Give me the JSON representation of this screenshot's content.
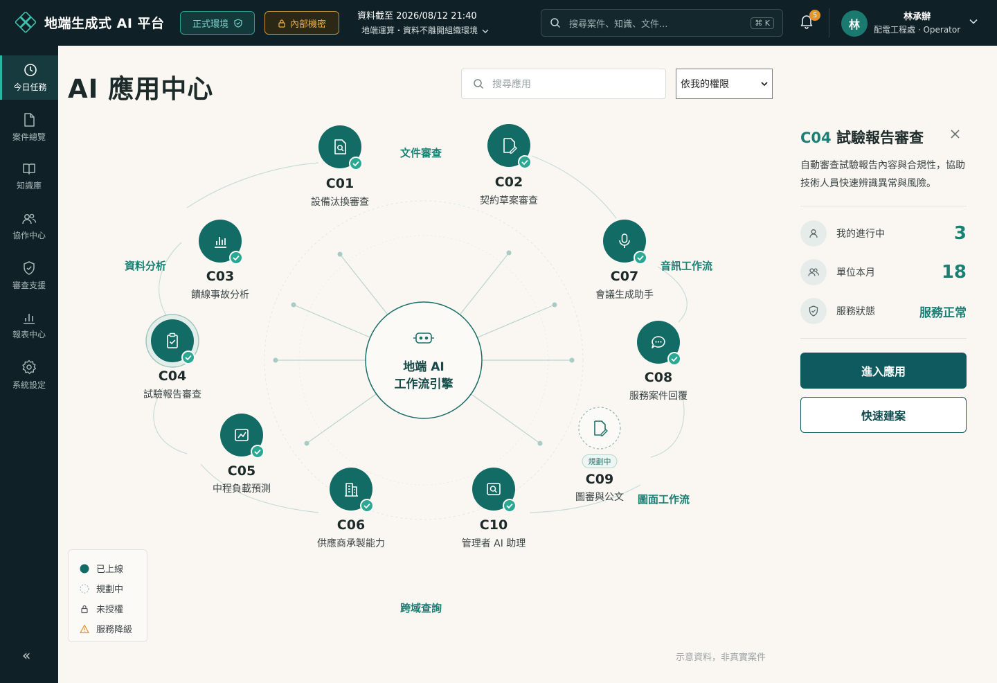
{
  "header": {
    "brand": "地端生成式 AI 平台",
    "env_label": "正式環境",
    "confidential_label": "內部機密",
    "data_as_of": "資料截至 2026/08/12 21:40",
    "data_scope": "地端運算・資料不離開組織環境",
    "search_placeholder": "搜尋案件、知識、文件...",
    "search_shortcut": "⌘ K",
    "notification_count": "5",
    "user_initial": "林",
    "user_name": "林承辦",
    "user_role": "配電工程處 · Operator"
  },
  "sidebar": {
    "items": [
      {
        "label": "今日任務",
        "icon": "clock-icon",
        "active": true
      },
      {
        "label": "案件總覽",
        "icon": "document-icon"
      },
      {
        "label": "知識庫",
        "icon": "book-icon"
      },
      {
        "label": "協作中心",
        "icon": "users-icon"
      },
      {
        "label": "審查支援",
        "icon": "shield-check-icon"
      },
      {
        "label": "報表中心",
        "icon": "bar-chart-icon"
      },
      {
        "label": "系統設定",
        "icon": "gear-icon"
      }
    ],
    "collapse_label": "«"
  },
  "main": {
    "title": "AI 應用中心",
    "search_placeholder": "搜尋應用",
    "filter_value": "依我的權限"
  },
  "hub": {
    "line1": "地端 AI",
    "line2": "工作流引擎"
  },
  "categories": [
    "文件審查",
    "資料分析",
    "音訊工作流",
    "圖面工作流",
    "跨域查詢"
  ],
  "apps": [
    {
      "code": "C01",
      "name": "設備汰換審查",
      "status": "online",
      "icon": "doc-search-icon"
    },
    {
      "code": "C02",
      "name": "契約草案審查",
      "status": "online",
      "icon": "doc-edit-icon"
    },
    {
      "code": "C03",
      "name": "饋線事故分析",
      "status": "online",
      "icon": "bar-chart-icon"
    },
    {
      "code": "C07",
      "name": "會議生成助手",
      "status": "online",
      "icon": "microphone-icon"
    },
    {
      "code": "C04",
      "name": "試驗報告審查",
      "status": "online",
      "icon": "clipboard-check-icon",
      "selected": true
    },
    {
      "code": "C08",
      "name": "服務案件回覆",
      "status": "online",
      "icon": "chat-icon"
    },
    {
      "code": "C05",
      "name": "中程負載預測",
      "status": "online",
      "icon": "line-chart-icon"
    },
    {
      "code": "C06",
      "name": "供應商承製能力",
      "status": "online",
      "icon": "building-icon"
    },
    {
      "code": "C10",
      "name": "管理者 AI 助理",
      "status": "online",
      "icon": "image-search-icon"
    },
    {
      "code": "C09",
      "name": "圖審與公文",
      "status": "planning",
      "icon": "doc-edit-icon",
      "badge": "規劃中"
    }
  ],
  "legend": [
    {
      "label": "已上線",
      "icon": "filled-dot-icon"
    },
    {
      "label": "規劃中",
      "icon": "dashed-circle-icon"
    },
    {
      "label": "未授權",
      "icon": "lock-icon"
    },
    {
      "label": "服務降級",
      "icon": "warning-icon"
    }
  ],
  "note": "示意資料，非真實案件",
  "detail": {
    "code": "C04",
    "title": "試驗報告審查",
    "description": "自動審查試驗報告內容與合規性，協助技術人員快速辨識異常與風險。",
    "stats": [
      {
        "label": "我的進行中",
        "value": "3",
        "icon": "user-icon"
      },
      {
        "label": "單位本月",
        "value": "18",
        "icon": "users-icon"
      },
      {
        "label": "服務狀態",
        "value": "服務正常",
        "icon": "shield-check-icon"
      }
    ],
    "enter_label": "進入應用",
    "quick_label": "快速建案"
  },
  "colors": {
    "primary": "#0f5a5e",
    "accent": "#1b7f74",
    "topbar": "#0f2127",
    "background": "#faf7f2",
    "warning": "#e5942b"
  }
}
